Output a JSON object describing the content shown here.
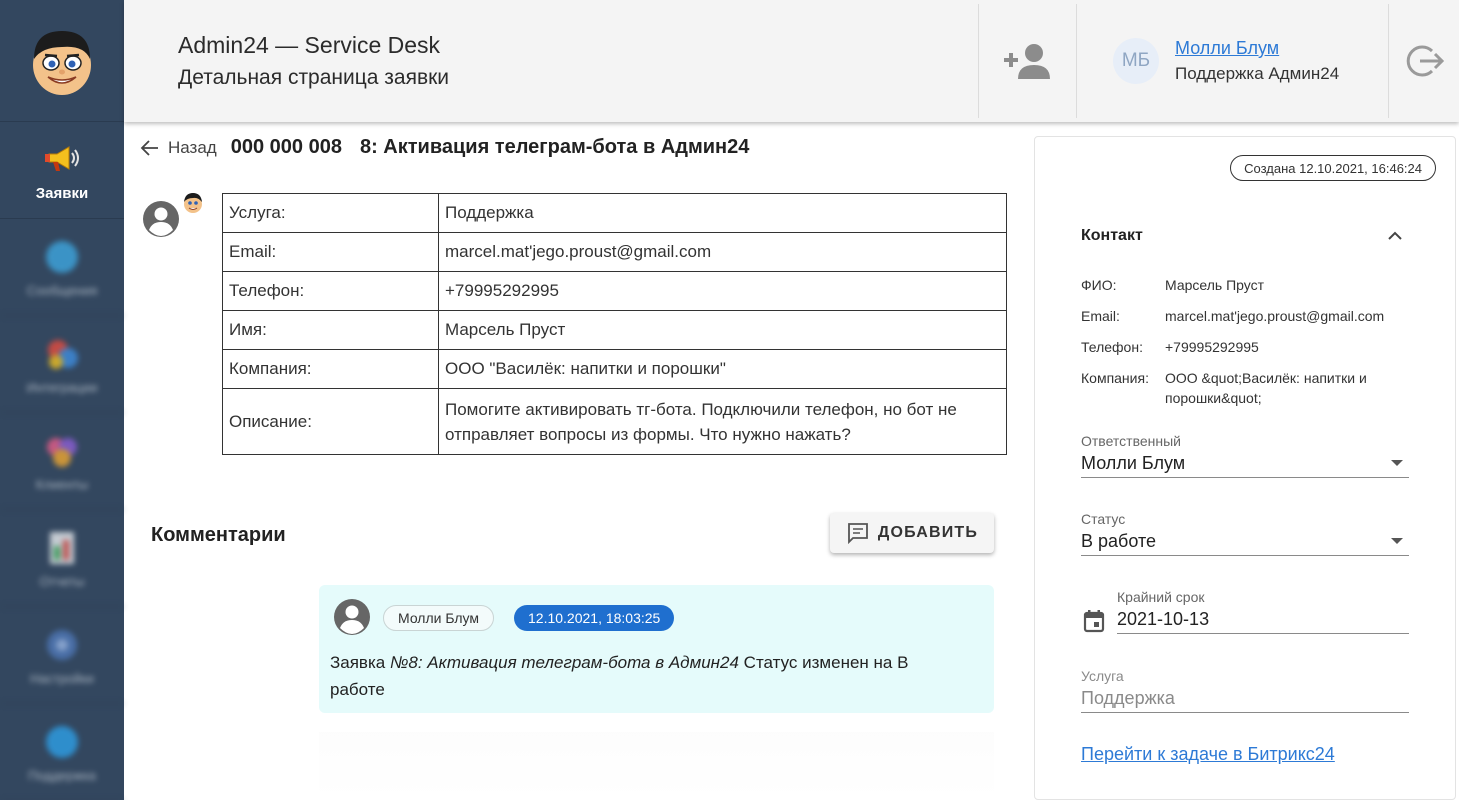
{
  "sidebar": {
    "logo_icon": "smiley-avatar-logo",
    "items": [
      {
        "label": "Заявки",
        "icon": "megaphone-icon",
        "active": true
      },
      {
        "label": "Сообщения",
        "icon": "chat-icon",
        "active": false
      },
      {
        "label": "Интеграции",
        "icon": "integrations-icon",
        "active": false
      },
      {
        "label": "Клиенты",
        "icon": "clients-icon",
        "active": false
      },
      {
        "label": "Отчеты",
        "icon": "reports-icon",
        "active": false
      },
      {
        "label": "Настройки",
        "icon": "settings-icon",
        "active": false
      },
      {
        "label": "Поддержка",
        "icon": "support-icon",
        "active": false
      }
    ]
  },
  "header": {
    "title": "Admin24 — Service Desk",
    "subtitle": "Детальная страница заявки",
    "user": {
      "initials": "МБ",
      "name": "Молли Блум",
      "org": "Поддержка Админ24"
    }
  },
  "ticket": {
    "back_label": "Назад",
    "number": "000 000 008",
    "title": "8: Активация телеграм-бота в Админ24",
    "fields": [
      {
        "key": "Услуга:",
        "value": "Поддержка"
      },
      {
        "key": "Email:",
        "value": "marcel.mat'jego.proust@gmail.com"
      },
      {
        "key": "Телефон:",
        "value": "+79995292995"
      },
      {
        "key": "Имя:",
        "value": "Марсель Пруст"
      },
      {
        "key": "Компания:",
        "value": "ООО \"Василёк: напитки и порошки\""
      },
      {
        "key": "Описание:",
        "value": "Помогите активировать тг-бота. Подключили телефон, но бот не отправляет вопросы из формы. Что нужно нажать?"
      }
    ]
  },
  "comments": {
    "title": "Комментарии",
    "add_label": "ДОБАВИТЬ",
    "items": [
      {
        "author": "Молли Блум",
        "date": "12.10.2021, 18:03:25",
        "text_prefix": "Заявка ",
        "text_italic": "№8: Активация телеграм-бота в Админ24",
        "text_suffix": " Статус изменен на В работе"
      }
    ]
  },
  "panel": {
    "created": "Создана 12.10.2021, 16:46:24",
    "contact_title": "Контакт",
    "contact": [
      {
        "key": "ФИО:",
        "value": "Марсель Пруст"
      },
      {
        "key": "Email:",
        "value": "marcel.mat'jego.proust@gmail.com"
      },
      {
        "key": "Телефон:",
        "value": "+79995292995"
      },
      {
        "key": "Компания:",
        "value": "ООО &quot;Василёк: напитки и порошки&quot;"
      }
    ],
    "responsible": {
      "label": "Ответственный",
      "value": "Молли Блум"
    },
    "status": {
      "label": "Статус",
      "value": "В работе"
    },
    "deadline": {
      "label": "Крайний срок",
      "value": "2021-10-13"
    },
    "service": {
      "label": "Услуга",
      "value": "Поддержка"
    },
    "bitrix_link": "Перейти к задаче в Битрикс24"
  },
  "colors": {
    "sidebar_bg": "#33475f",
    "accent": "#2d7ad6",
    "date_chip": "#1f6fcf",
    "comment_bg": "#e5fbfb"
  }
}
